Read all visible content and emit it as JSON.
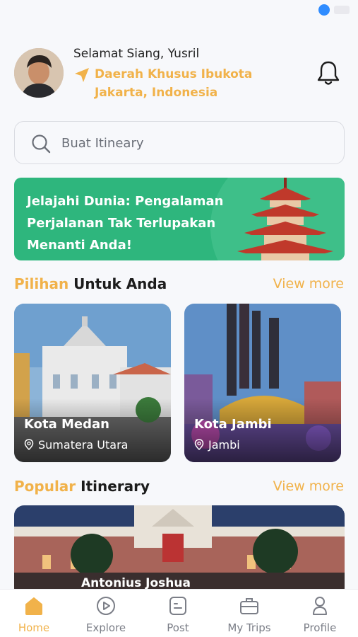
{
  "header": {
    "greeting": "Selamat Siang, Yusril",
    "location": "Daerah Khusus Ibukota Jakarta, Indonesia"
  },
  "search": {
    "placeholder": "Buat Itineary"
  },
  "banner": {
    "text": "Jelajahi Dunia: Pengalaman Perjalanan Tak Terlupakan Menanti Anda!"
  },
  "recommendations": {
    "title_accent": "Pilihan",
    "title_rest": " Untuk Anda",
    "view_more": "View more",
    "cards": [
      {
        "title": "Kota Medan",
        "subtitle": "Sumatera Utara"
      },
      {
        "title": "Kota Jambi",
        "subtitle": "Jambi"
      }
    ]
  },
  "popular": {
    "title_accent": "Popular",
    "title_rest": " Itinerary",
    "view_more": "View more",
    "card": {
      "author": "Antonius Joshua"
    }
  },
  "tabs": {
    "home": "Home",
    "explore": "Explore",
    "post": "Post",
    "trips": "My Trips",
    "profile": "Profile"
  },
  "colors": {
    "accent": "#f1b24a",
    "banner": "#2eb67d"
  }
}
